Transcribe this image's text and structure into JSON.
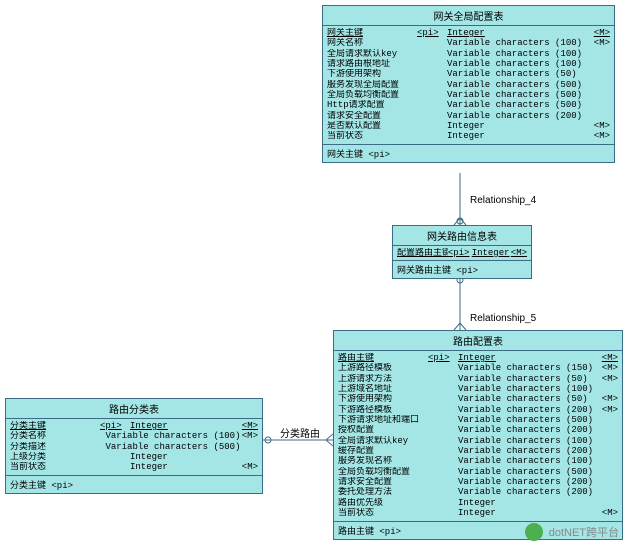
{
  "watermark": {
    "text": "dotNET跨平台"
  },
  "relationships": {
    "r4": "Relationship_4",
    "r5": "Relationship_5",
    "r_class": "分类路由"
  },
  "entities": {
    "gateway_global": {
      "title": "网关全局配置表",
      "pk_footer": "网关主键  <pi>",
      "rows": [
        {
          "name": "网关主键",
          "pi": "<pi>",
          "type": "Integer",
          "m": "<M>",
          "u": true
        },
        {
          "name": "网关名称",
          "pi": "",
          "type": "Variable characters (100)",
          "m": "<M>"
        },
        {
          "name": "全局请求默认key",
          "pi": "",
          "type": "Variable characters (100)",
          "m": ""
        },
        {
          "name": "请求路由根地址",
          "pi": "",
          "type": "Variable characters (100)",
          "m": ""
        },
        {
          "name": "下游使用架构",
          "pi": "",
          "type": "Variable characters (50)",
          "m": ""
        },
        {
          "name": "服务发现全局配置",
          "pi": "",
          "type": "Variable characters (500)",
          "m": ""
        },
        {
          "name": "全局负载均衡配置",
          "pi": "",
          "type": "Variable characters (500)",
          "m": ""
        },
        {
          "name": "Http请求配置",
          "pi": "",
          "type": "Variable characters (500)",
          "m": ""
        },
        {
          "name": "请求安全配置",
          "pi": "",
          "type": "Variable characters (200)",
          "m": ""
        },
        {
          "name": "是否默认配置",
          "pi": "",
          "type": "Integer",
          "m": "<M>"
        },
        {
          "name": "当前状态",
          "pi": "",
          "type": "Integer",
          "m": "<M>"
        }
      ]
    },
    "gateway_route_info": {
      "title": "网关路由信息表",
      "pk_footer": "网关路由主键  <pi>",
      "rows": [
        {
          "name": "配置路由主键",
          "pi": "<pi>",
          "type": "Integer",
          "m": "<M>",
          "u": true
        }
      ]
    },
    "route_config": {
      "title": "路由配置表",
      "pk_footer": "路由主键  <pi>",
      "rows": [
        {
          "name": "路由主键",
          "pi": "<pi>",
          "type": "Integer",
          "m": "<M>",
          "u": true
        },
        {
          "name": "上游路径模板",
          "pi": "",
          "type": "Variable characters (150)",
          "m": "<M>"
        },
        {
          "name": "上游请求方法",
          "pi": "",
          "type": "Variable characters (50)",
          "m": "<M>"
        },
        {
          "name": "上游域名地址",
          "pi": "",
          "type": "Variable characters (100)",
          "m": ""
        },
        {
          "name": "下游使用架构",
          "pi": "",
          "type": "Variable characters (50)",
          "m": "<M>"
        },
        {
          "name": "下游路径模板",
          "pi": "",
          "type": "Variable characters (200)",
          "m": "<M>"
        },
        {
          "name": "下游请求地址和端口",
          "pi": "",
          "type": "Variable characters (500)",
          "m": ""
        },
        {
          "name": "授权配置",
          "pi": "",
          "type": "Variable characters (200)",
          "m": ""
        },
        {
          "name": "全局请求默认key",
          "pi": "",
          "type": "Variable characters (100)",
          "m": ""
        },
        {
          "name": "缓存配置",
          "pi": "",
          "type": "Variable characters (200)",
          "m": ""
        },
        {
          "name": "服务发现名称",
          "pi": "",
          "type": "Variable characters (100)",
          "m": ""
        },
        {
          "name": "全局负载均衡配置",
          "pi": "",
          "type": "Variable characters (500)",
          "m": ""
        },
        {
          "name": "请求安全配置",
          "pi": "",
          "type": "Variable characters (200)",
          "m": ""
        },
        {
          "name": "委托处理方法",
          "pi": "",
          "type": "Variable characters (200)",
          "m": ""
        },
        {
          "name": "路由优先级",
          "pi": "",
          "type": "Integer",
          "m": ""
        },
        {
          "name": "当前状态",
          "pi": "",
          "type": "Integer",
          "m": "<M>"
        }
      ]
    },
    "route_category": {
      "title": "路由分类表",
      "pk_footer": "分类主键  <pi>",
      "rows": [
        {
          "name": "分类主键",
          "pi": "<pi>",
          "type": "Integer",
          "m": "<M>",
          "u": true
        },
        {
          "name": "分类名称",
          "pi": "",
          "type": "Variable characters (100)",
          "m": "<M>"
        },
        {
          "name": "分类描述",
          "pi": "",
          "type": "Variable characters (500)",
          "m": ""
        },
        {
          "name": "上级分类",
          "pi": "",
          "type": "Integer",
          "m": ""
        },
        {
          "name": "当前状态",
          "pi": "",
          "type": "Integer",
          "m": "<M>"
        }
      ]
    }
  }
}
